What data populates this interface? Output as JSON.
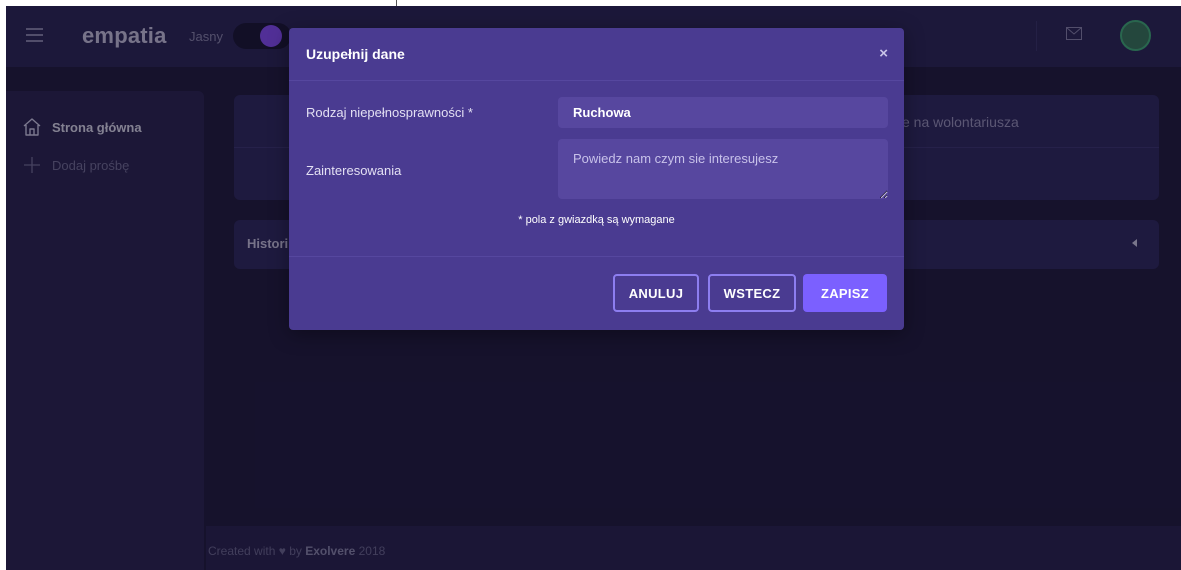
{
  "header": {
    "logo": "empatia",
    "theme_label": "Jasny"
  },
  "sidebar": {
    "items": [
      {
        "label": "Strona główna",
        "icon": "home-icon"
      },
      {
        "label": "Dodaj prośbę",
        "icon": "plus-icon"
      }
    ]
  },
  "main": {
    "card1_text": "e na wolontariusza",
    "card2_title": "Histori"
  },
  "footer": {
    "prefix": "Created with",
    "heart": "♥",
    "by": "by",
    "brand": "Exolvere",
    "year": "2018"
  },
  "modal": {
    "title": "Uzupełnij dane",
    "close": "×",
    "fields": {
      "disability_label": "Rodzaj niepełnosprawności *",
      "disability_value": "Ruchowa",
      "interests_label": "Zainteresowania",
      "interests_placeholder": "Powiedz nam czym sie interesujesz"
    },
    "required_note": "* pola z gwiazdką są wymagane",
    "buttons": {
      "cancel": "ANULUJ",
      "back": "WSTECZ",
      "save": "ZAPISZ"
    }
  },
  "colors": {
    "background": "#1f1b3d",
    "modal": "#4a3b91",
    "accent": "#7b60ff",
    "toggle_knob": "#8a4fff"
  }
}
